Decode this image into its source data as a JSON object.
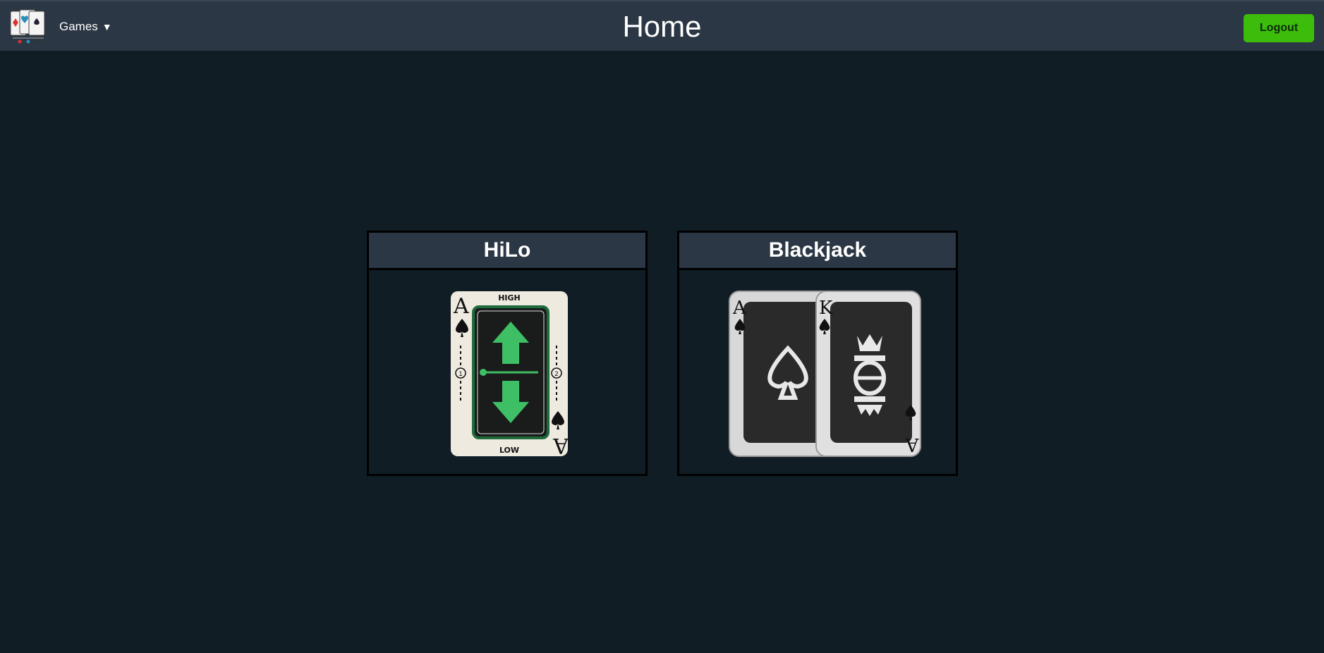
{
  "header": {
    "logo_icon": "playing-cards-logo-icon",
    "games_label": "Games",
    "games_caret": "▼",
    "title": "Home",
    "logout_label": "Logout"
  },
  "games": [
    {
      "name": "HiLo",
      "image_icon": "hilo-card-icon",
      "card": {
        "rank": "A",
        "top_text": "HIGH",
        "bottom_text": "LOW",
        "left_num": "1",
        "right_num": "2"
      }
    },
    {
      "name": "Blackjack",
      "image_icon": "blackjack-cards-icon",
      "cards": [
        {
          "rank": "A"
        },
        {
          "rank": "K"
        }
      ]
    }
  ],
  "colors": {
    "background": "#111d25",
    "bar": "#2b3744",
    "accent": "#3cbd0c",
    "hilo_green": "#3fbf65"
  }
}
